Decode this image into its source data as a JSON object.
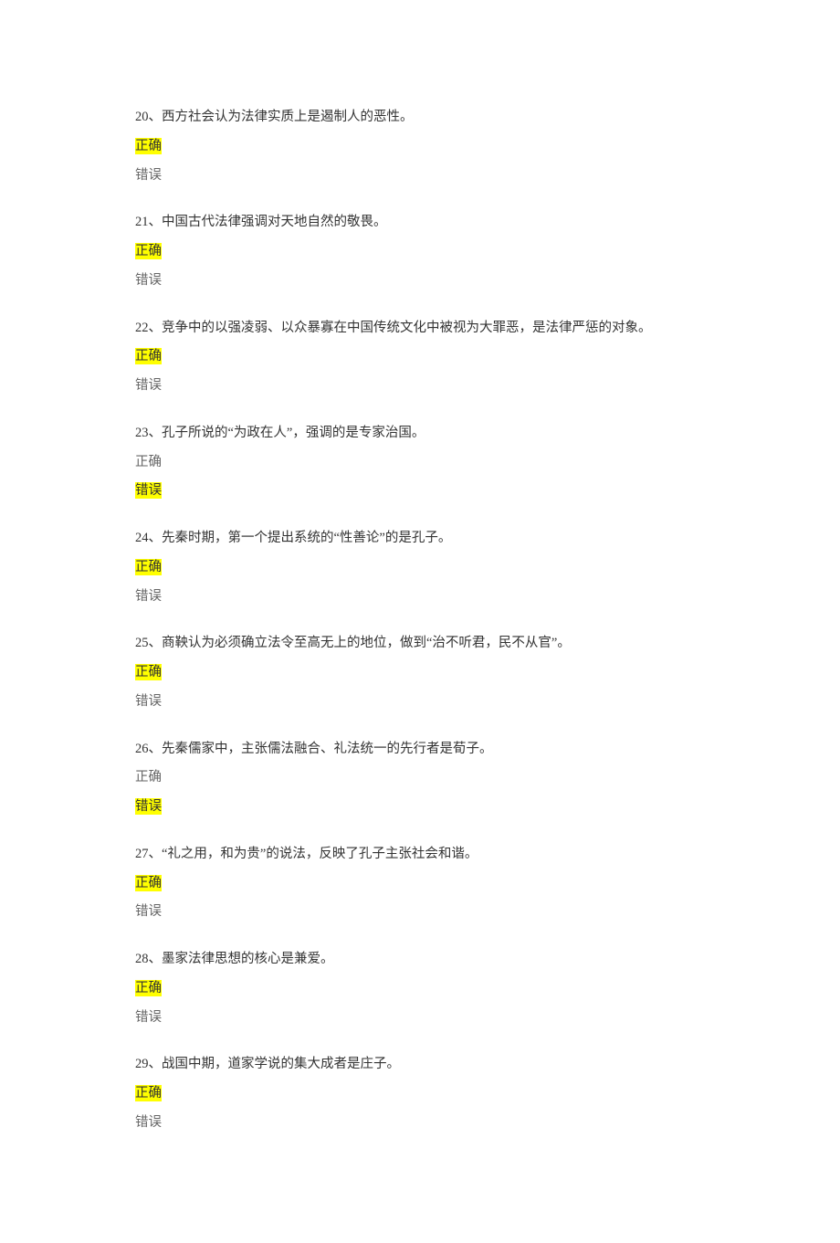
{
  "questions": [
    {
      "number": "20",
      "text": "20、西方社会认为法律实质上是遏制人的恶性。",
      "correct_label": "正确",
      "wrong_label": "错误",
      "highlighted": "correct"
    },
    {
      "number": "21",
      "text": "21、中国古代法律强调对天地自然的敬畏。",
      "correct_label": "正确",
      "wrong_label": "错误",
      "highlighted": "correct"
    },
    {
      "number": "22",
      "text": "22、竞争中的以强凌弱、以众暴寡在中国传统文化中被视为大罪恶，是法律严惩的对象。",
      "correct_label": "正确",
      "wrong_label": "错误",
      "highlighted": "correct"
    },
    {
      "number": "23",
      "text": "23、孔子所说的“为政在人”，强调的是专家治国。",
      "correct_label": "正确",
      "wrong_label": "错误",
      "highlighted": "wrong"
    },
    {
      "number": "24",
      "text": "24、先秦时期，第一个提出系统的“性善论”的是孔子。",
      "correct_label": "正确",
      "wrong_label": "错误",
      "highlighted": "correct"
    },
    {
      "number": "25",
      "text": "25、商鞅认为必须确立法令至高无上的地位，做到“治不听君，民不从官”。",
      "correct_label": "正确",
      "wrong_label": "错误",
      "highlighted": "correct"
    },
    {
      "number": "26",
      "text": "26、先秦儒家中，主张儒法融合、礼法统一的先行者是荀子。",
      "correct_label": "正确",
      "wrong_label": "错误",
      "highlighted": "wrong"
    },
    {
      "number": "27",
      "text": "27、“礼之用，和为贵”的说法，反映了孔子主张社会和谐。",
      "correct_label": "正确",
      "wrong_label": "错误",
      "highlighted": "correct"
    },
    {
      "number": "28",
      "text": "28、墨家法律思想的核心是兼爱。",
      "correct_label": "正确",
      "wrong_label": "错误",
      "highlighted": "correct"
    },
    {
      "number": "29",
      "text": "29、战国中期，道家学说的集大成者是庄子。",
      "correct_label": "正确",
      "wrong_label": "错误",
      "highlighted": "correct"
    }
  ]
}
